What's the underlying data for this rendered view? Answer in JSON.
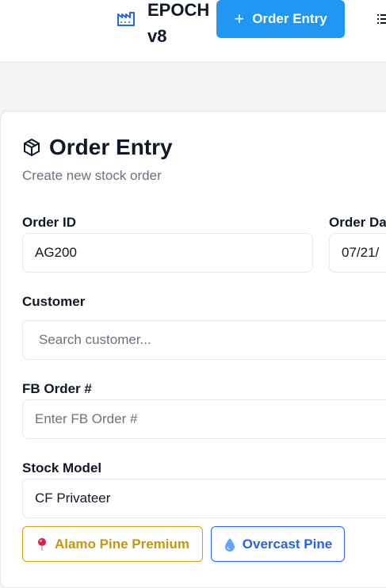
{
  "header": {
    "brand": "EPOCH v8",
    "primary_action": "Order Entry"
  },
  "page": {
    "title": "Order Entry",
    "subtitle": "Create new stock order"
  },
  "form": {
    "order_id": {
      "label": "Order ID",
      "value": "AG200"
    },
    "order_date": {
      "label": "Order Date",
      "value": "07/21/"
    },
    "customer": {
      "label": "Customer",
      "placeholder": "Search customer..."
    },
    "fb_order": {
      "label": "FB Order #",
      "placeholder": "Enter FB Order #"
    },
    "stock_model": {
      "label": "Stock Model",
      "value": "CF Privateer"
    }
  },
  "chips": [
    {
      "label": "Alamo Pine Premium",
      "icon": "pin-icon",
      "color": "#c8960a"
    },
    {
      "label": "Overcast Pine",
      "icon": "droplet-icon",
      "color": "#2563eb"
    }
  ],
  "colors": {
    "primary": "#2196f3",
    "brand_icon": "#2563eb"
  }
}
